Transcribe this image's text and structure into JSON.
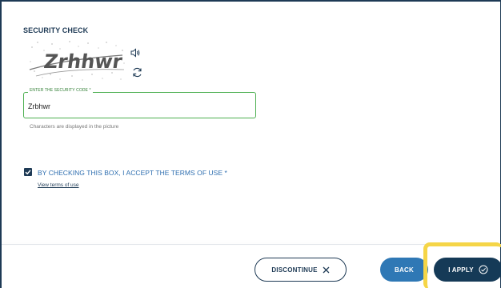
{
  "security": {
    "title": "SECURITY CHECK",
    "captcha_text": "Zrhhwr",
    "field_label": "ENTER THE SECURITY CODE *",
    "field_value": "Zrbhwr",
    "hint": "Characters are displayed in the picture",
    "audio_icon": "speaker-icon",
    "refresh_icon": "refresh-icon"
  },
  "terms": {
    "checked": true,
    "label": "BY CHECKING THIS BOX, I ACCEPT THE TERMS OF USE *",
    "link": "View terms of use"
  },
  "footer": {
    "discontinue_label": "DISCONTINUE",
    "back_label": "BACK",
    "apply_label": "I APPLY"
  },
  "colors": {
    "navy": "#1e3a55",
    "field_border": "#4caf50",
    "terms_text": "#2f6fb0",
    "back_button": "#2f78b5",
    "apply_button": "#153a57",
    "highlight": "#f5d547"
  }
}
